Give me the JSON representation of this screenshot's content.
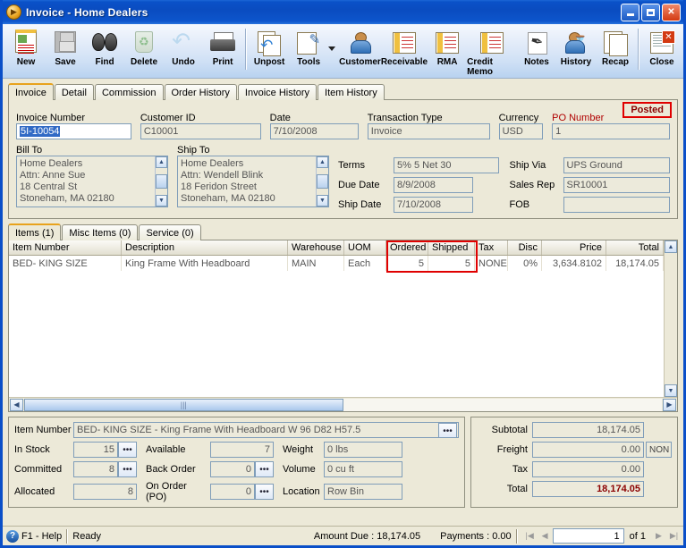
{
  "window": {
    "title": "Invoice - Home Dealers",
    "icon": "invoice-app-icon",
    "minimize": "_",
    "maximize": "□",
    "close": "✕"
  },
  "toolbar": {
    "buttons": [
      {
        "label": "New",
        "icon": "new-document-icon",
        "disabled": false
      },
      {
        "label": "Save",
        "icon": "save-floppy-icon",
        "disabled": true
      },
      {
        "label": "Find",
        "icon": "binoculars-icon",
        "disabled": false
      },
      {
        "label": "Delete",
        "icon": "recycle-bin-icon",
        "disabled": true
      },
      {
        "label": "Undo",
        "icon": "undo-arrow-icon",
        "disabled": true
      },
      {
        "label": "Print",
        "icon": "printer-icon",
        "disabled": false
      },
      {
        "label": "Unpost",
        "icon": "unpost-stack-icon",
        "disabled": false
      },
      {
        "label": "Tools",
        "icon": "tools-icon",
        "disabled": false
      },
      {
        "label": "Customer",
        "icon": "customer-person-icon",
        "disabled": false
      },
      {
        "label": "Receivable",
        "icon": "receivable-card-icon",
        "disabled": false
      },
      {
        "label": "RMA",
        "icon": "rma-money-icon",
        "disabled": false
      },
      {
        "label": "Credit Memo",
        "icon": "credit-memo-icon",
        "disabled": false
      },
      {
        "label": "Notes",
        "icon": "notepad-pen-icon",
        "disabled": false
      },
      {
        "label": "History",
        "icon": "history-person-clock-icon",
        "disabled": false
      },
      {
        "label": "Recap",
        "icon": "recap-pages-icon",
        "disabled": false
      },
      {
        "label": "Close",
        "icon": "close-window-icon",
        "disabled": false
      }
    ],
    "tools_caret": "caret-down-icon"
  },
  "tabs": [
    {
      "label": "Invoice",
      "active": true
    },
    {
      "label": "Detail",
      "active": false
    },
    {
      "label": "Commission",
      "active": false
    },
    {
      "label": "Order History",
      "active": false
    },
    {
      "label": "Invoice History",
      "active": false
    },
    {
      "label": "Item History",
      "active": false
    }
  ],
  "header": {
    "status_badge": "Posted",
    "fields": {
      "invoice_number_label": "Invoice Number",
      "invoice_number_value": "5I-10054",
      "customer_id_label": "Customer ID",
      "customer_id_value": "C10001",
      "date_label": "Date",
      "date_value": "7/10/2008",
      "transaction_type_label": "Transaction Type",
      "transaction_type_value": "Invoice",
      "currency_label": "Currency",
      "currency_value": "USD",
      "po_number_label": "PO Number",
      "po_number_value": "1"
    }
  },
  "addresses": {
    "bill_to_label": "Bill To",
    "bill_to_value": "Home Dealers\nAttn: Anne Sue\n18 Central St\nStoneham, MA 02180",
    "ship_to_label": "Ship To",
    "ship_to_value": "Home Dealers\nAttn: Wendell Blink\n18 Feridon Street\nStoneham, MA 02180"
  },
  "terms": {
    "terms_label": "Terms",
    "terms_value": "5% 5 Net 30",
    "due_date_label": "Due Date",
    "due_date_value": "8/9/2008",
    "ship_date_label": "Ship Date",
    "ship_date_value": "7/10/2008",
    "ship_via_label": "Ship Via",
    "ship_via_value": "UPS Ground",
    "sales_rep_label": "Sales Rep",
    "sales_rep_value": "SR10001",
    "fob_label": "FOB",
    "fob_value": ""
  },
  "item_tabs": [
    {
      "label": "Items (1)",
      "active": true
    },
    {
      "label": "Misc Items (0)",
      "active": false
    },
    {
      "label": "Service (0)",
      "active": false
    }
  ],
  "grid": {
    "columns": [
      "Item Number",
      "Description",
      "Warehouse",
      "UOM",
      "Ordered",
      "Shipped",
      "Tax",
      "Disc",
      "Price",
      "Total"
    ],
    "rows": [
      {
        "item_number": "BED- KING SIZE",
        "description": "King Frame With  Headboard",
        "warehouse": "MAIN",
        "uom": "Each",
        "ordered": "5",
        "shipped": "5",
        "tax": "NONE",
        "disc": "0%",
        "price": "3,634.8102",
        "total": "18,174.05"
      }
    ],
    "highlight_columns": [
      "Ordered",
      "Shipped"
    ],
    "highlight_color": "#e00000"
  },
  "item_detail": {
    "item_number_label": "Item Number",
    "item_number_value": "BED- KING SIZE - King Frame With  Headboard W 96 D82  H57.5",
    "in_stock_label": "In Stock",
    "in_stock_value": "15",
    "committed_label": "Committed",
    "committed_value": "8",
    "allocated_label": "Allocated",
    "allocated_value": "8",
    "available_label": "Available",
    "available_value": "7",
    "back_order_label": "Back Order",
    "back_order_value": "0",
    "on_order_label": "On Order (PO)",
    "on_order_value": "0",
    "weight_label": "Weight",
    "weight_value": "0 lbs",
    "volume_label": "Volume",
    "volume_value": "0 cu ft",
    "location_label": "Location",
    "location_value": "Row  Bin",
    "lookup_icon": "ellipsis-lookup-icon"
  },
  "totals": {
    "subtotal_label": "Subtotal",
    "subtotal_value": "18,174.05",
    "freight_label": "Freight",
    "freight_value": "0.00",
    "freight_tax_code": "NON",
    "tax_label": "Tax",
    "tax_value": "0.00",
    "total_label": "Total",
    "total_value": "18,174.05",
    "total_color": "#8b0000"
  },
  "statusbar": {
    "help_icon": "help-circle-icon",
    "help_text": "F1 - Help",
    "ready_text": "Ready",
    "amount_due": "Amount Due : 18,174.05",
    "payments": "Payments : 0.00",
    "nav_first": "first-record-icon",
    "nav_prev": "prev-record-icon",
    "nav_next": "next-record-icon",
    "nav_last": "last-record-icon",
    "page_value": "1",
    "page_of": "of  1"
  }
}
